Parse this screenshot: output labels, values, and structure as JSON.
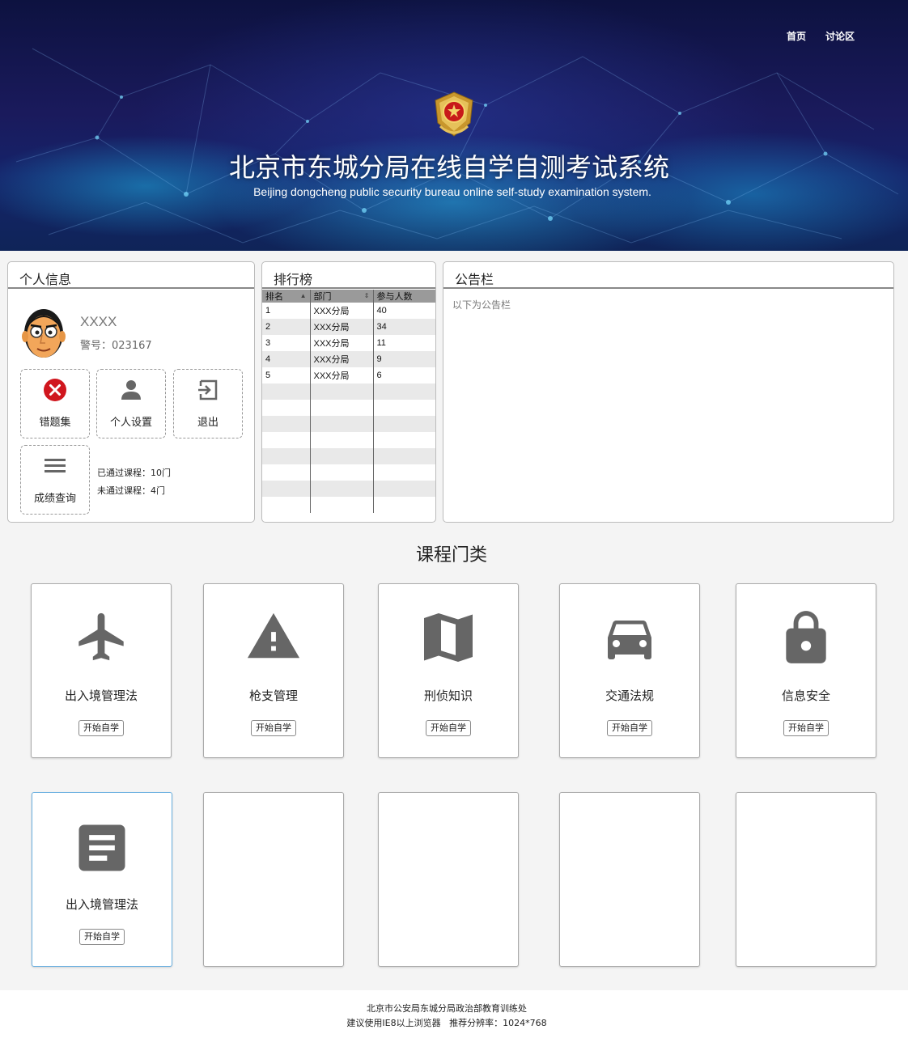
{
  "nav": {
    "home": "首页",
    "forum": "讨论区"
  },
  "header": {
    "title_cn": "北京市东城分局在线自学自测考试系统",
    "title_en": "Beijing dongcheng public security bureau online self-study examination system."
  },
  "profile": {
    "heading": "个人信息",
    "name": "XXXX",
    "badge": "警号：023167",
    "actions": [
      {
        "label": "错题集",
        "icon": "error-icon",
        "color": "#d0161e"
      },
      {
        "label": "个人设置",
        "icon": "person-icon"
      },
      {
        "label": "退出",
        "icon": "exit-icon"
      },
      {
        "label": "成绩查询",
        "icon": "menu-icon"
      }
    ],
    "passed": "已通过课程：10门",
    "failed": "未通过课程：4门"
  },
  "ranking": {
    "heading": "排行榜",
    "columns": [
      "排名",
      "部门",
      "参与人数"
    ],
    "rows": [
      [
        "1",
        "XXX分局",
        "40"
      ],
      [
        "2",
        "XXX分局",
        "34"
      ],
      [
        "3",
        "XXX分局",
        "11"
      ],
      [
        "4",
        "XXX分局",
        "9"
      ],
      [
        "5",
        "XXX分局",
        "6"
      ],
      [
        "",
        "",
        ""
      ],
      [
        "",
        "",
        ""
      ],
      [
        "",
        "",
        ""
      ],
      [
        "",
        "",
        ""
      ],
      [
        "",
        "",
        ""
      ],
      [
        "",
        "",
        ""
      ],
      [
        "",
        "",
        ""
      ],
      [
        "",
        "",
        ""
      ]
    ]
  },
  "notice": {
    "heading": "公告栏",
    "text": "以下为公告栏"
  },
  "courses": {
    "heading": "课程门类",
    "items": [
      {
        "name": "出入境管理法",
        "icon": "airplane-icon",
        "button": "开始自学"
      },
      {
        "name": "枪支管理",
        "icon": "warning-icon",
        "button": "开始自学"
      },
      {
        "name": "刑侦知识",
        "icon": "map-icon",
        "button": "开始自学"
      },
      {
        "name": "交通法规",
        "icon": "car-icon",
        "button": "开始自学"
      },
      {
        "name": "信息安全",
        "icon": "lock-icon",
        "button": "开始自学"
      },
      {
        "name": "出入境管理法",
        "icon": "document-icon",
        "button": "开始自学"
      }
    ]
  },
  "footer": {
    "line1": "北京市公安局东城分局政治部教育训练处",
    "line2": "建议使用IE8以上浏览器   推荐分辨率：1024*768"
  },
  "colors": {
    "icon_gray": "#666666",
    "accent_blue": "#6ab0e0"
  }
}
